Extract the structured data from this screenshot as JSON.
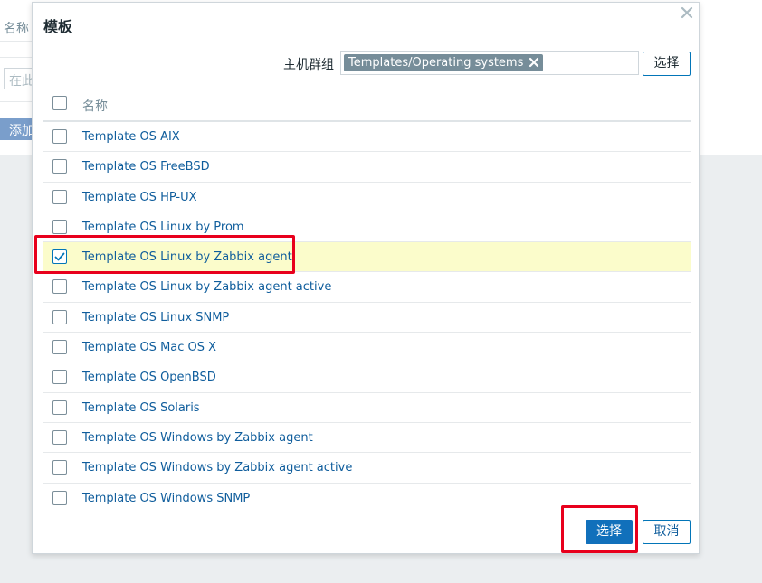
{
  "background": {
    "name_label": "名称",
    "input_placeholder": "在此",
    "add_button": "添加"
  },
  "dialog": {
    "title": "模板",
    "close_icon": "close-icon",
    "filter": {
      "label": "主机群组",
      "tag": "Templates/Operating systems",
      "select_button": "选择"
    },
    "table": {
      "header": "名称",
      "rows": [
        {
          "name": "Template OS AIX",
          "checked": false
        },
        {
          "name": "Template OS FreeBSD",
          "checked": false
        },
        {
          "name": "Template OS HP-UX",
          "checked": false
        },
        {
          "name": "Template OS Linux by Prom",
          "checked": false
        },
        {
          "name": "Template OS Linux by Zabbix agent",
          "checked": true
        },
        {
          "name": "Template OS Linux by Zabbix agent active",
          "checked": false
        },
        {
          "name": "Template OS Linux SNMP",
          "checked": false
        },
        {
          "name": "Template OS Mac OS X",
          "checked": false
        },
        {
          "name": "Template OS OpenBSD",
          "checked": false
        },
        {
          "name": "Template OS Solaris",
          "checked": false
        },
        {
          "name": "Template OS Windows by Zabbix agent",
          "checked": false
        },
        {
          "name": "Template OS Windows by Zabbix agent active",
          "checked": false
        },
        {
          "name": "Template OS Windows SNMP",
          "checked": false
        }
      ]
    },
    "footer": {
      "select_button": "选择",
      "cancel_button": "取消"
    }
  },
  "colors": {
    "link": "#0f5d9c",
    "primary": "#1170bb",
    "selected_row": "#fbfccb",
    "highlight": "#e8001c",
    "tag_bg": "#768d99"
  }
}
